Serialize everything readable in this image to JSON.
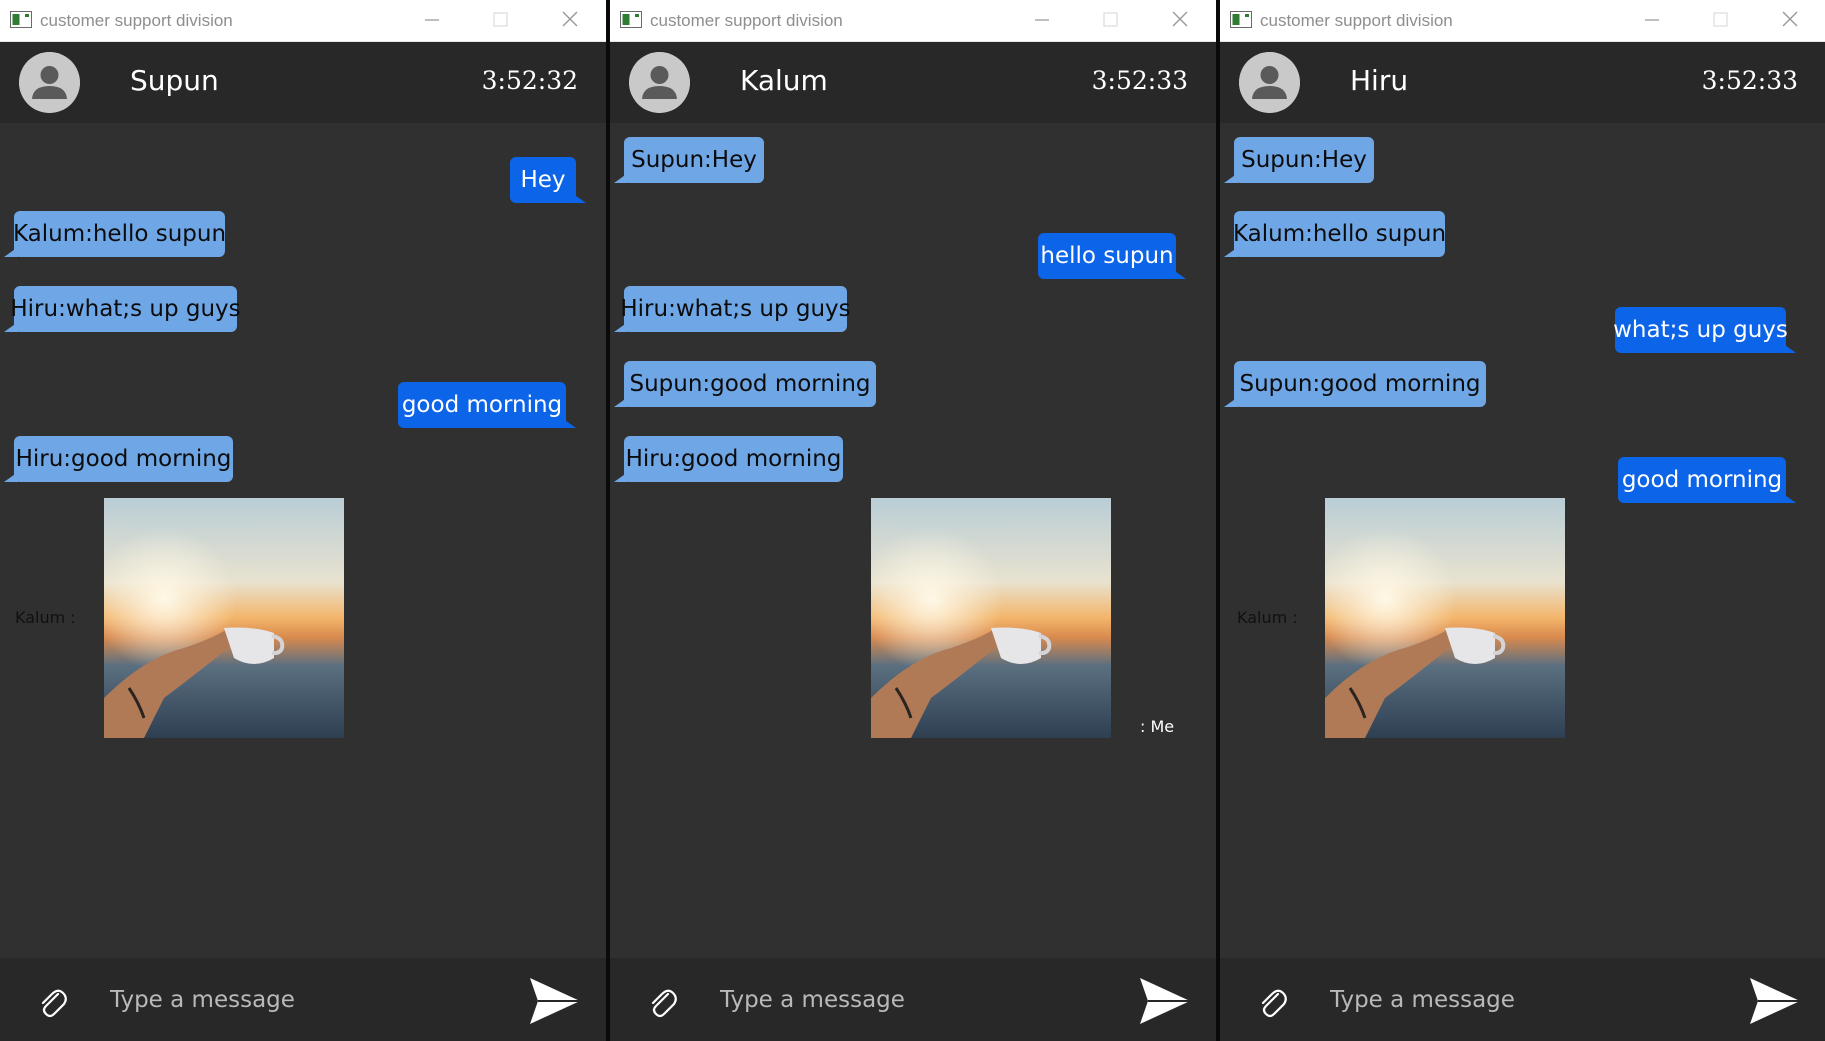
{
  "windows": [
    {
      "title": "customer support division",
      "contact_name": "Supun",
      "time": "3:52:32",
      "messages": [
        {
          "kind": "out",
          "text": "Hey"
        },
        {
          "kind": "in",
          "text": "Kalum:hello supun"
        },
        {
          "kind": "in",
          "text": "Hiru:what;s up guys"
        },
        {
          "kind": "out",
          "text": "good morning"
        },
        {
          "kind": "in",
          "text": "Hiru:good morning"
        }
      ],
      "image_sender_label": "Kalum :",
      "composer_placeholder": "Type a message"
    },
    {
      "title": "customer support division",
      "contact_name": "Kalum",
      "time": "3:52:33",
      "messages": [
        {
          "kind": "in",
          "text": "Supun:Hey"
        },
        {
          "kind": "out",
          "text": "hello supun"
        },
        {
          "kind": "in",
          "text": "Hiru:what;s up guys"
        },
        {
          "kind": "in",
          "text": "Supun:good morning"
        },
        {
          "kind": "in",
          "text": "Hiru:good morning"
        }
      ],
      "image_sender_label": ": Me",
      "composer_placeholder": "Type a message"
    },
    {
      "title": "customer support division",
      "contact_name": "Hiru",
      "time": "3:52:33",
      "messages": [
        {
          "kind": "in",
          "text": "Supun:Hey"
        },
        {
          "kind": "in",
          "text": "Kalum:hello supun"
        },
        {
          "kind": "out",
          "text": "what;s up guys"
        },
        {
          "kind": "in",
          "text": "Supun:good morning"
        },
        {
          "kind": "out",
          "text": "good morning"
        }
      ],
      "image_sender_label": "Kalum :",
      "composer_placeholder": "Type a message"
    }
  ],
  "colors": {
    "incoming_bubble": "#6ea6e6",
    "outgoing_bubble": "#0c64e8",
    "chat_background": "#303030",
    "header_background": "#282828"
  },
  "icons": {
    "window": "app-icon",
    "avatar": "user-silhouette-icon",
    "attach": "paperclip-icon",
    "send": "send-arrow-icon",
    "minimize": "minimize-icon",
    "maximize": "maximize-icon",
    "close": "close-icon"
  }
}
